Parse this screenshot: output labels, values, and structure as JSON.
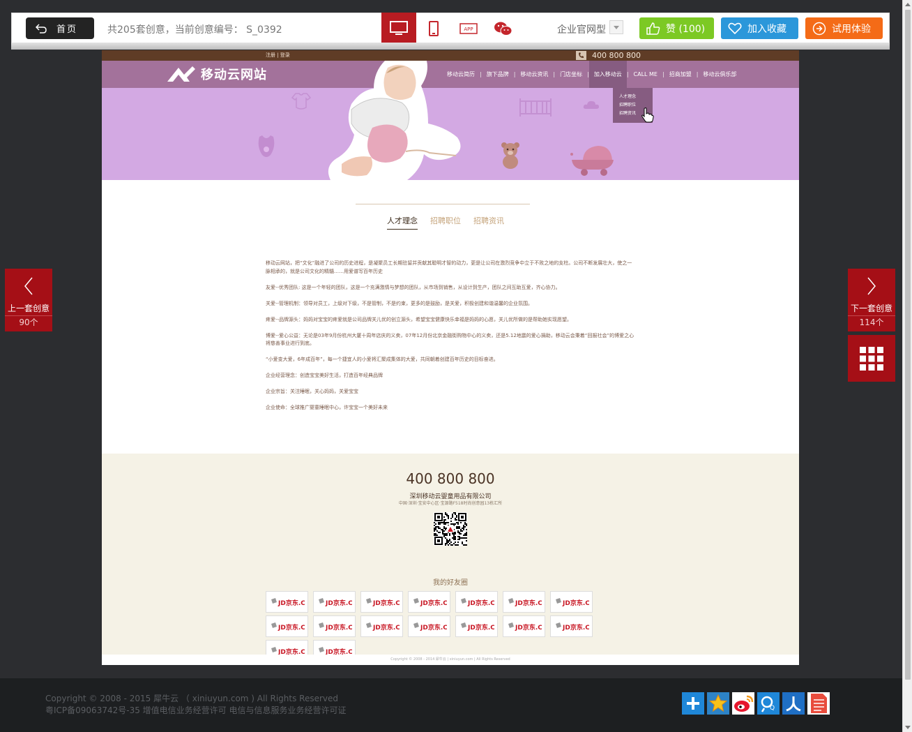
{
  "toolbar": {
    "home_label": "首页",
    "info": "共205套创意，当前创意编号： S_0392",
    "devices": [
      "desktop-icon",
      "tablet-icon",
      "app-icon",
      "wechat-icon"
    ],
    "app_icon_text": "APP",
    "site_type": "企业官网型",
    "like_label": "赞 (100)",
    "fav_label": "加入收藏",
    "try_label": "试用体验"
  },
  "site": {
    "util_links": "注册 | 登录",
    "phone": "400 800 800",
    "logo_text": "移动云网站",
    "nav": [
      "移动云简历",
      "旗下品牌",
      "移动云资讯",
      "门店坐标",
      "加入移动云",
      "CALL ME",
      "招商加盟",
      "移动云俱乐部"
    ],
    "dropdown": [
      "人才理念",
      "招聘职位",
      "招聘资讯"
    ],
    "tabs": [
      "人才理念",
      "招聘职位",
      "招聘资讯"
    ],
    "paragraphs": [
      "移动云网站，把“文化”融进了公司的历史进程，是凝聚员工长期驻留并贡献其聪明才智的动力，更是让公司在激烈竞争中立于不败之地的支柱。公司不断发展壮大，使之一脉相承的，就是公司文化的精髓……用爱谱写百年历史",
      "友爱--优秀团队: 这是一个年轻的团队，这是一个充满激情与梦想的团队，从市场到销售，从设计到生产，团队之间互助互爱，齐心协力。",
      "关爱--管理机制：领导对员工，上级对下级，不是管制，不是约束，更多的是鼓励，是关爱，积极创建和谐温馨的企业氛围。",
      "疼爱--品牌源头：妈妈对宝宝的疼爱就是公司品牌关儿优的创立源头，希望宝宝健康快乐幸福是妈妈的心愿，关儿优所做的是帮助她实现愿望。",
      "博爱--爱心公益：无论是03年9月份杭州大厦十周年店庆的义卖，07年12月份北京金融街购物中心的义卖，还是5.12地震的爱心捐助，移动云会秉着“回报社会”的博爱之心将慈善事业进行到底。",
      "“小爱变大爱，6年成百年”，每一个捷宜人的小爱将汇聚成集体的大爱，共同朝着创建百年历史的目标奋进。",
      "企业经营理念：创造宝宝美好生活，打造百年经典品牌",
      "企业宗旨：关注睡眠，关心妈妈，关爱宝宝",
      "企业使命：全球推广婴童睡眠中心，许宝宝一个美好未来"
    ],
    "footer_phone": "400 800 800",
    "company": "深圳移动云婴童用品有限公司",
    "address": "中国·深圳·宝安中心区·宝源路F518时尚创意园13栋汇所",
    "friends_title": "我的好友圈",
    "partner_logo": "JD京东.COM",
    "copyright": "Copyright © 2008 - 2014 犀牛云 | xiniuyun.com | All Rights Reserved"
  },
  "side": {
    "prev_label": "上一套创意",
    "prev_count": "90个",
    "next_label": "下一套创意",
    "next_count": "114个"
  },
  "bottom": {
    "line1": "Copyright © 2008 - 2015 犀牛云 （ xiniuyun.com ) All Rights Reserved",
    "line2": "粤ICP备09063742号-35 增值电信业务经营许可 电信与信息服务业务经营许可证",
    "share_icons": [
      "more-share-icon",
      "qzone-icon",
      "weibo-icon",
      "tencent-weibo-icon",
      "renren-icon",
      "douban-icon"
    ]
  },
  "colors": {
    "accent_red": "#a50f16",
    "like_green": "#7cc924",
    "fav_blue": "#2b97da",
    "try_orange": "#f46b17",
    "hero_purple": "#d3a9e3",
    "nav_purple": "#a3729b"
  }
}
